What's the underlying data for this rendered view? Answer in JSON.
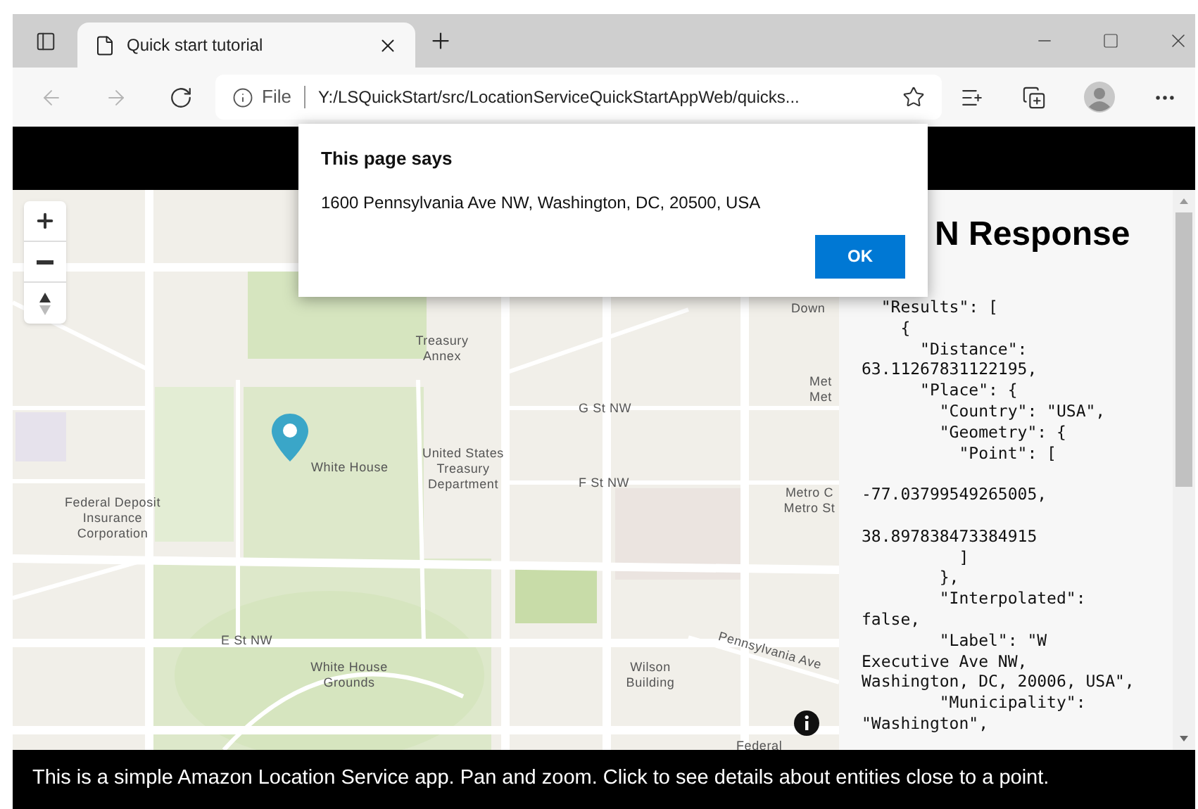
{
  "browser": {
    "tab": {
      "title": "Quick start tutorial",
      "selected": true
    },
    "address": {
      "scheme": "File",
      "url": "Y:/LSQuickStart/src/LocationServiceQuickStartAppWeb/quicks..."
    }
  },
  "map": {
    "labels": [
      {
        "text": "Treasury Annex"
      },
      {
        "text": "G St NW"
      },
      {
        "text": "White House"
      },
      {
        "text": "United States Treasury Department"
      },
      {
        "text": "F St NW"
      },
      {
        "text": "Federal Deposit Insurance Corporation"
      },
      {
        "text": "Metro C Metro St"
      },
      {
        "text": "E St NW"
      },
      {
        "text": "Pennsylvania Ave"
      },
      {
        "text": "White House Grounds"
      },
      {
        "text": "Wilson Building"
      },
      {
        "text": "Down"
      },
      {
        "text": "Met Met"
      },
      {
        "text": "Federal"
      }
    ]
  },
  "json_panel": {
    "heading": "N Response",
    "lines": [
      "  \"Results\": [",
      "    {",
      "      \"Distance\":",
      "63.11267831122195,",
      "      \"Place\": {",
      "        \"Country\": \"USA\",",
      "        \"Geometry\": {",
      "          \"Point\": [",
      "\n-77.03799549265005,",
      "\n38.897838473384915",
      "          ]",
      "        },",
      "        \"Interpolated\":",
      "false,",
      "        \"Label\": \"W",
      "Executive Ave NW,",
      "Washington, DC, 20006, USA\",",
      "        \"Municipality\":",
      "\"Washington\","
    ]
  },
  "dialog": {
    "title": "This page says",
    "message": "1600 Pennsylvania Ave NW, Washington, DC, 20500, USA",
    "button": "OK"
  },
  "footer": "This is a simple Amazon Location Service app. Pan and zoom. Click to see details about entities close to a point."
}
